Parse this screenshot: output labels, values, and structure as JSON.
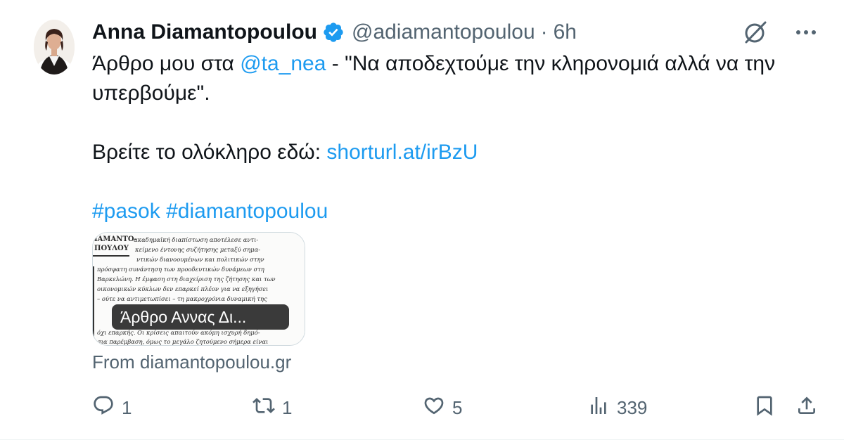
{
  "tweet": {
    "author": {
      "display_name": "Anna Diamantopoulou",
      "handle": "@adiamantopoulou",
      "verified": true,
      "verified_color": "#1d9bf0"
    },
    "separator": "·",
    "time": "6h",
    "text": {
      "line1_prefix": "Άρθρο μου στα ",
      "mention": "@ta_nea",
      "line1_suffix": " - \"Να αποδεχτούμε την κληρονομιά αλλά να την υπερβούμε\".",
      "line2_prefix": "Βρείτε το ολόκληρο εδώ: ",
      "url": "shorturl.at/irBzU",
      "hashtag1": "#pasok",
      "hashtag2": "#diamantopoulou"
    },
    "card": {
      "title": "Άρθρο Αννας Δι...",
      "source": "From diamantopoulou.gr",
      "thumbnail_text": [
        "ΙΑΜΑΝΤΟ-",
        "ΠΟΥΛΟΥ",
        "ακαδημαϊκή διαπίστωση αποτέλεσε αντι-",
        "κείμενο έντονης συζήτησης μεταξύ σημα-",
        "ντικών διανοουμένων και πολιτικών στην",
        "πρόσφατη συνάντηση των προοδευτικών δυνάμεων στη",
        "Βαρκελώνη. Η έμφαση στη διαχείριση της ζήτησης και των",
        "οικονομικών κύκλων δεν επαρκεί πλέον για να εξηγήσει",
        "– ούτε να αντιμετωπίσει – τη μακροχρόνια δυναμική της",
        "όχι επαρκής. Οι κρίσεις απαιτούν ακόμη ισχυρή δημό-",
        "σια παρέμβαση, όμως το μεγάλο ζητούμενο σήμερα είναι"
      ]
    },
    "metrics": {
      "replies": "1",
      "retweets": "1",
      "likes": "5",
      "views": "339"
    },
    "icons": {
      "grok": "grok-icon",
      "more": "more-icon",
      "reply": "reply-icon",
      "retweet": "retweet-icon",
      "like": "heart-icon",
      "views": "views-icon",
      "bookmark": "bookmark-icon",
      "share": "share-icon"
    },
    "colors": {
      "link": "#1d9bf0",
      "secondary_text": "#536471",
      "primary_text": "#0f1419"
    }
  }
}
